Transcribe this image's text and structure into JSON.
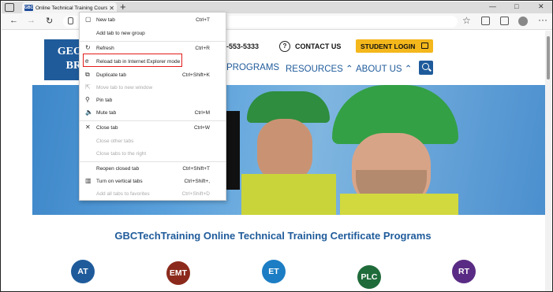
{
  "browser": {
    "tab_title": "Online Technical Training Course",
    "favicon_text": "GBC",
    "new_tab_symbol": "+",
    "tab_close_symbol": "✕"
  },
  "window_controls": {
    "minimize": "—",
    "maximize": "□",
    "close": "✕"
  },
  "toolbar": {
    "back": "←",
    "forward": "→",
    "refresh": "↻",
    "favorite": "☆",
    "more": "···"
  },
  "context_menu": {
    "items": [
      {
        "label": "New tab",
        "shortcut": "Ctrl+T",
        "icon": "new-tab-icon",
        "glyph": "▢",
        "enabled": true
      },
      {
        "label": "Add tab to new group",
        "shortcut": "",
        "icon": "",
        "glyph": "",
        "enabled": true
      },
      {
        "label": "Refresh",
        "shortcut": "Ctrl+R",
        "icon": "refresh-icon",
        "glyph": "↻",
        "enabled": true
      },
      {
        "label": "Reload tab in Internet Explorer mode",
        "shortcut": "",
        "icon": "ie-mode-icon",
        "glyph": "e",
        "enabled": true
      },
      {
        "label": "Duplicate tab",
        "shortcut": "Ctrl+Shift+K",
        "icon": "duplicate-icon",
        "glyph": "⧉",
        "enabled": true
      },
      {
        "label": "Move tab to new window",
        "shortcut": "",
        "icon": "move-window-icon",
        "glyph": "⇱",
        "enabled": false
      },
      {
        "label": "Pin tab",
        "shortcut": "",
        "icon": "pin-icon",
        "glyph": "⚲",
        "enabled": true
      },
      {
        "label": "Mute tab",
        "shortcut": "Ctrl+M",
        "icon": "mute-icon",
        "glyph": "🔈",
        "enabled": true
      },
      {
        "label": "Close tab",
        "shortcut": "Ctrl+W",
        "icon": "close-icon",
        "glyph": "✕",
        "enabled": true
      },
      {
        "label": "Close other tabs",
        "shortcut": "",
        "icon": "",
        "glyph": "",
        "enabled": false
      },
      {
        "label": "Close tabs to the right",
        "shortcut": "",
        "icon": "",
        "glyph": "",
        "enabled": false
      },
      {
        "label": "Reopen closed tab",
        "shortcut": "Ctrl+Shift+T",
        "icon": "",
        "glyph": "",
        "enabled": true
      },
      {
        "label": "Turn on vertical tabs",
        "shortcut": "Ctrl+Shift+,",
        "icon": "vertical-tabs-icon",
        "glyph": "▥",
        "enabled": true
      },
      {
        "label": "Add all tabs to favorites",
        "shortcut": "Ctrl+Shift+D",
        "icon": "",
        "glyph": "",
        "enabled": false
      }
    ]
  },
  "site": {
    "logo_line1": "GEOR",
    "logo_line2": "BRO",
    "phone": "-553-5333",
    "contact_icon": "?",
    "contact_label": "CONTACT US",
    "student_login": "STUDENT LOGIN",
    "nav": [
      "PROGRAMS",
      "RESOURCES ⌃",
      "ABOUT US ⌃"
    ],
    "heading": "GBCTechTraining Online Technical Training Certificate Programs",
    "badges": [
      {
        "label": "AT",
        "color": "#1f5b9b"
      },
      {
        "label": "EMT",
        "color": "#8b2a1c"
      },
      {
        "label": "ET",
        "color": "#1c7dc4"
      },
      {
        "label": "PLC",
        "color": "#1f6b3a"
      },
      {
        "label": "RT",
        "color": "#5a2b84"
      }
    ]
  }
}
